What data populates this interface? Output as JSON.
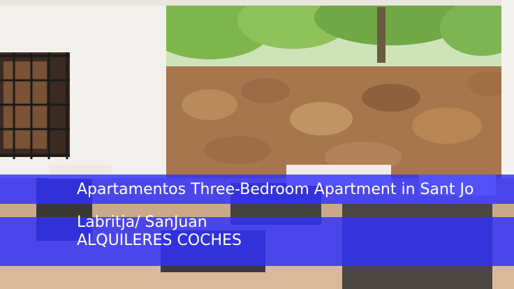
{
  "listing": {
    "title": "Apartamentos Three-Bedroom Apartment in Sant Jo",
    "location": "Labritja/ SanJuan",
    "category": "ALQUILERES COCHES"
  },
  "photo": {
    "subject": "patio-with-wicker-furniture-and-stone-wall"
  },
  "colors": {
    "banner": "#3030ff",
    "text": "#ffffff"
  }
}
